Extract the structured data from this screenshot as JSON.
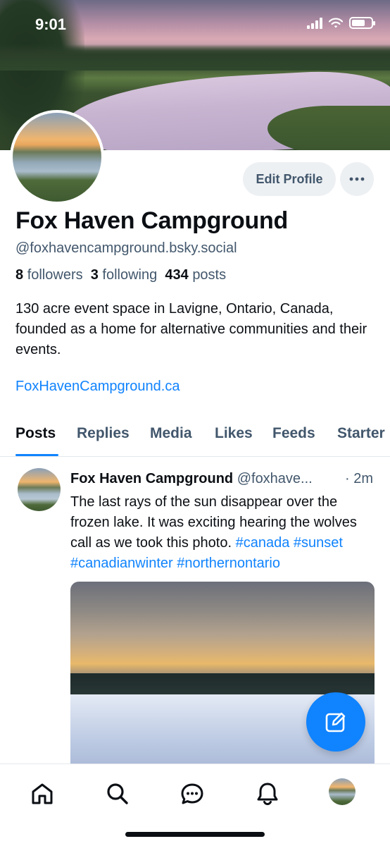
{
  "status_bar": {
    "time": "9:01"
  },
  "profile": {
    "name": "Fox Haven Campground",
    "handle": "@foxhavencampground.bsky.social",
    "followers_count": "8",
    "followers_label": "followers",
    "following_count": "3",
    "following_label": "following",
    "posts_count": "434",
    "posts_label": "posts",
    "bio": "130 acre event space in Lavigne, Ontario, Canada, founded as a home for alternative communities and their events.",
    "website": "FoxHavenCampground.ca",
    "edit_button": "Edit Profile",
    "more_icon": "ellipsis-icon"
  },
  "tabs": [
    {
      "label": "Posts",
      "active": true
    },
    {
      "label": "Replies",
      "active": false
    },
    {
      "label": "Media",
      "active": false
    },
    {
      "label": "Likes",
      "active": false
    },
    {
      "label": "Feeds",
      "active": false
    },
    {
      "label": "Starter",
      "active": false
    }
  ],
  "post": {
    "author": "Fox Haven Campground",
    "handle": "@foxhave...",
    "time": "· 2m",
    "text_plain": "The last rays of the sun disappear over the frozen lake. It was exciting hearing the wolves call as we took this photo.",
    "hashtags": [
      "#canada",
      "#sunset",
      "#canadianwinter",
      "#northernontario"
    ]
  },
  "bottom_nav": {
    "items": [
      "home-icon",
      "search-icon",
      "chat-icon",
      "bell-icon",
      "profile-avatar"
    ]
  },
  "colors": {
    "accent": "#1083fe",
    "muted_text": "#42576c",
    "button_bg": "#edf0f3"
  }
}
